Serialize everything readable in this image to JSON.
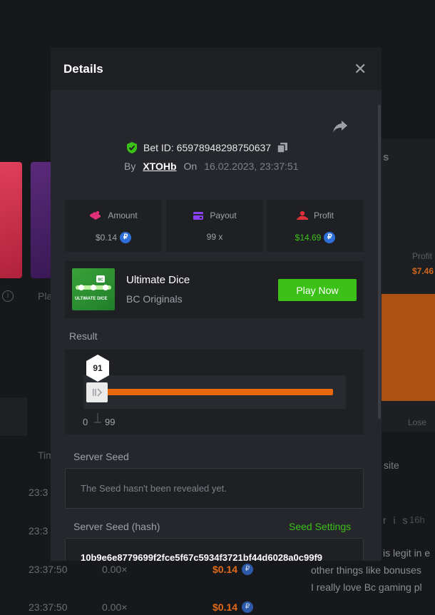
{
  "background": {
    "left_text": "Pla",
    "tab_text": "Tim",
    "rows": [
      {
        "time": "23:37:50",
        "mult": "0.00×",
        "amount": "$0.14"
      },
      {
        "time": "23:37:50",
        "mult": "0.00×",
        "amount": "$0.14"
      }
    ],
    "partial_times": [
      "23:3",
      "23:3"
    ],
    "right": {
      "heading_fragment": "s",
      "profit_label": "Profit",
      "profit_value": "$7.46",
      "lose_label": "Lose",
      "site_text": "site",
      "user_fragment": "r i s",
      "time_ago": "16h",
      "chat_lines": [
        "is legit in e",
        "other things like bonuses",
        "I really love Bc gaming pl"
      ]
    }
  },
  "modal": {
    "title": "Details",
    "bet_id_label": "Bet ID: 65978948298750637",
    "by_label": "By",
    "user": "XTOHb",
    "on_label": "On",
    "datetime": "16.02.2023, 23:37:51",
    "stats": [
      {
        "label": "Amount",
        "value": "$0.14",
        "value_color": "#9ea1a7",
        "has_coin": true
      },
      {
        "label": "Payout",
        "value": "99 x",
        "value_color": "#9ea1a7",
        "has_coin": false
      },
      {
        "label": "Profit",
        "value": "$14.69",
        "value_color": "#3bc117",
        "has_coin": true
      }
    ],
    "game": {
      "thumb_title": "ULTIMATE DICE",
      "name": "Ultimate Dice",
      "provider": "BC Originals",
      "play_label": "Play Now"
    },
    "result": {
      "label": "Result",
      "value": "91",
      "min": "0",
      "max": "99"
    },
    "server_seed": {
      "label": "Server Seed",
      "text": "The Seed hasn't been revealed yet."
    },
    "server_seed_hash": {
      "label": "Server Seed (hash)",
      "settings_label": "Seed Settings",
      "value": "10b9e6e8779699f2fce5f67c5934f3721bf44d6028a0c99f9"
    }
  },
  "colors": {
    "accent_green": "#3bc117",
    "accent_orange": "#e8670f",
    "coin_blue": "#2d6fd6"
  }
}
